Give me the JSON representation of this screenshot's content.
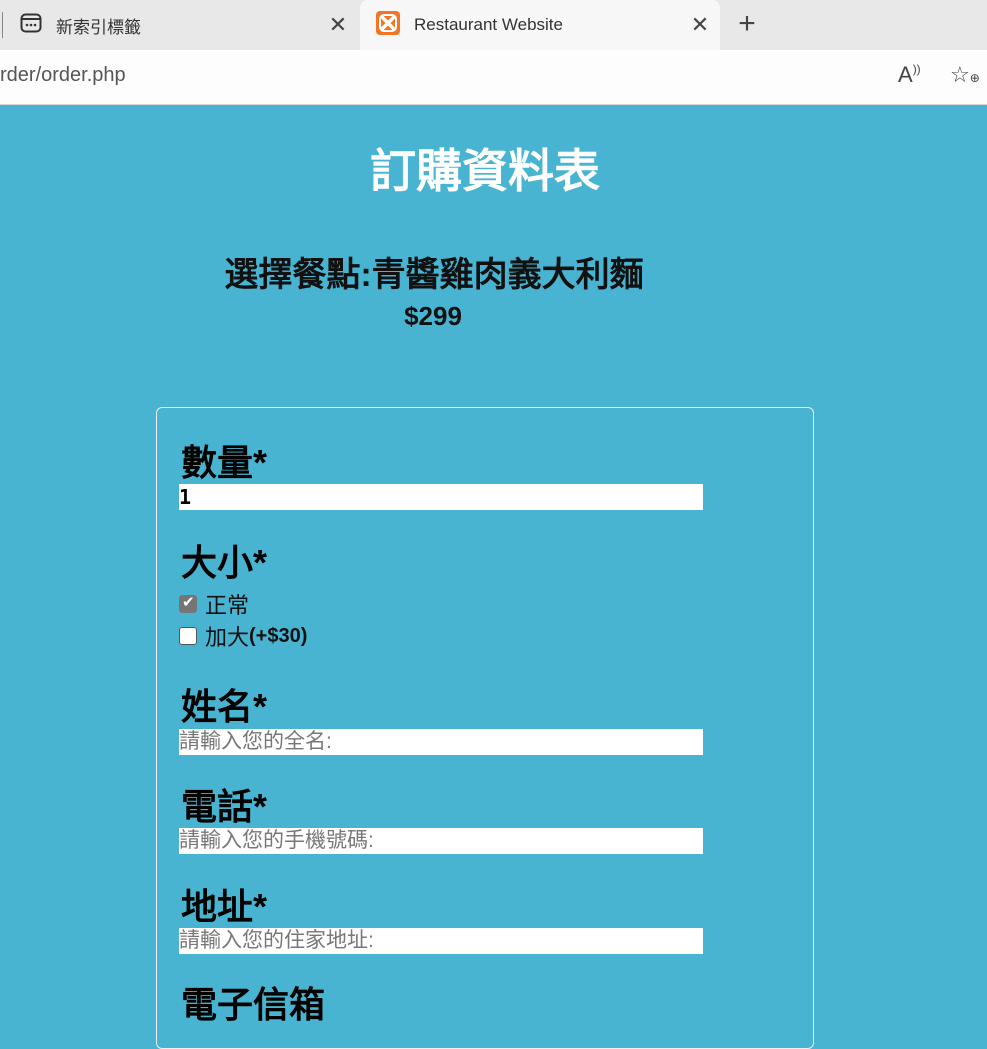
{
  "browser": {
    "tabs": [
      {
        "title": "新索引標籤",
        "icon": "new-tab-page-icon",
        "active": false
      },
      {
        "title": "Restaurant Website",
        "icon": "xampp-icon",
        "active": true
      }
    ],
    "url": "rder/order.php"
  },
  "page": {
    "title": "訂購資料表",
    "meal": "選擇餐點:青醬雞肉義大利麵",
    "price": "$299"
  },
  "form": {
    "quantity": {
      "label": "數量*",
      "value": "1"
    },
    "size": {
      "label": "大小*",
      "options": [
        {
          "label": "正常",
          "extra": "",
          "checked": true
        },
        {
          "label": "加大",
          "extra": "(+$30)",
          "checked": false
        }
      ]
    },
    "name": {
      "label": "姓名*",
      "placeholder": "請輸入您的全名:"
    },
    "phone": {
      "label": "電話*",
      "placeholder": "請輸入您的手機號碼:"
    },
    "address": {
      "label": "地址*",
      "placeholder": "請輸入您的住家地址:"
    },
    "email": {
      "label": "電子信箱"
    }
  },
  "colors": {
    "background": "#48b4d1",
    "title": "#ffffff"
  }
}
